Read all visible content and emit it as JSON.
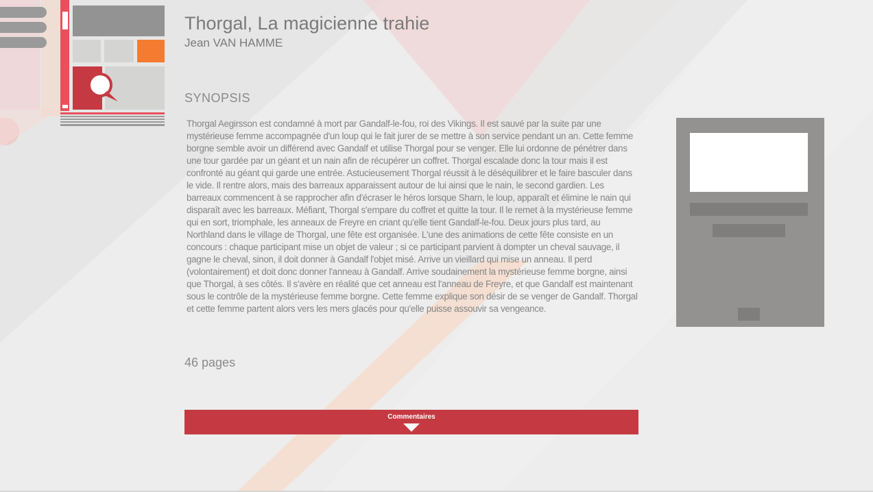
{
  "book": {
    "title": "Thorgal, La magicienne trahie",
    "author": "Jean VAN HAMME",
    "synopsis_heading": "SYNOPSIS",
    "synopsis": "Thorgal Aegirsson est condamné à mort par Gandalf-le-fou, roi des Vikings. Il est sauvé par la suite par une mystérieuse femme accompagnée d'un loup qui le fait jurer de se mettre à son service pendant un an. Cette femme borgne semble avoir un différend avec Gandalf et utilise Thorgal pour se venger. Elle lui ordonne de pénétrer dans une tour gardée par un géant et un nain afin de récupérer un coffret. Thorgal escalade donc la tour mais il est confronté au géant qui garde une entrée. Astucieusement Thorgal réussit à le déséquilibrer et le faire basculer dans le vide. Il rentre alors, mais des barreaux apparaissent autour de lui ainsi que le nain, le second gardien. Les barreaux commencent à se rapprocher afin d'écraser le héros lorsque Sharn, le loup, apparaît et élimine le nain qui disparaît avec les barreaux. Méfiant, Thorgal s'empare du coffret et quitte la tour. Il le remet à la mystérieuse femme qui en sort, triomphale, les anneaux de Freyre en criant qu'elle tient Gandalf-le-fou. Deux jours plus tard, au Northland dans le village de Thorgal, une fête est organisée. L'une des animations de cette fête consiste en un concours : chaque participant mise un objet de valeur ; si ce participant parvient à dompter un cheval sauvage, il gagne le cheval, sinon, il doit donner à Gandalf l'objet misé. Arrive un vieillard qui mise un anneau. Il perd (volontairement) et doit donc donner l'anneau à Gandalf. Arrive soudainement la mystérieuse femme borgne, ainsi que Thorgal, à ses côtés. Il s'avère en réalité que cet anneau est l'anneau de Freyre, et que Gandalf est maintenant sous le contrôle de la mystérieuse femme borgne. Cette femme explique son désir de se venger de Gandalf. Thorgal et cette femme partent alors vers les mers glacés pour qu'elle puisse assouvir sa vengeance.",
    "pages": "46 pages"
  },
  "comments": {
    "label": "Commentaires"
  },
  "icons": {
    "menu": "hamburger-menu-icon",
    "logo": "comic-strip-logo-icon",
    "toggle": "triangle-down-icon"
  },
  "colors": {
    "accent_red": "#c53a42",
    "logo_orange": "#f47b2f",
    "logo_pink": "#e8505b",
    "placeholder_gray": "#939290",
    "text_gray": "#858585"
  }
}
